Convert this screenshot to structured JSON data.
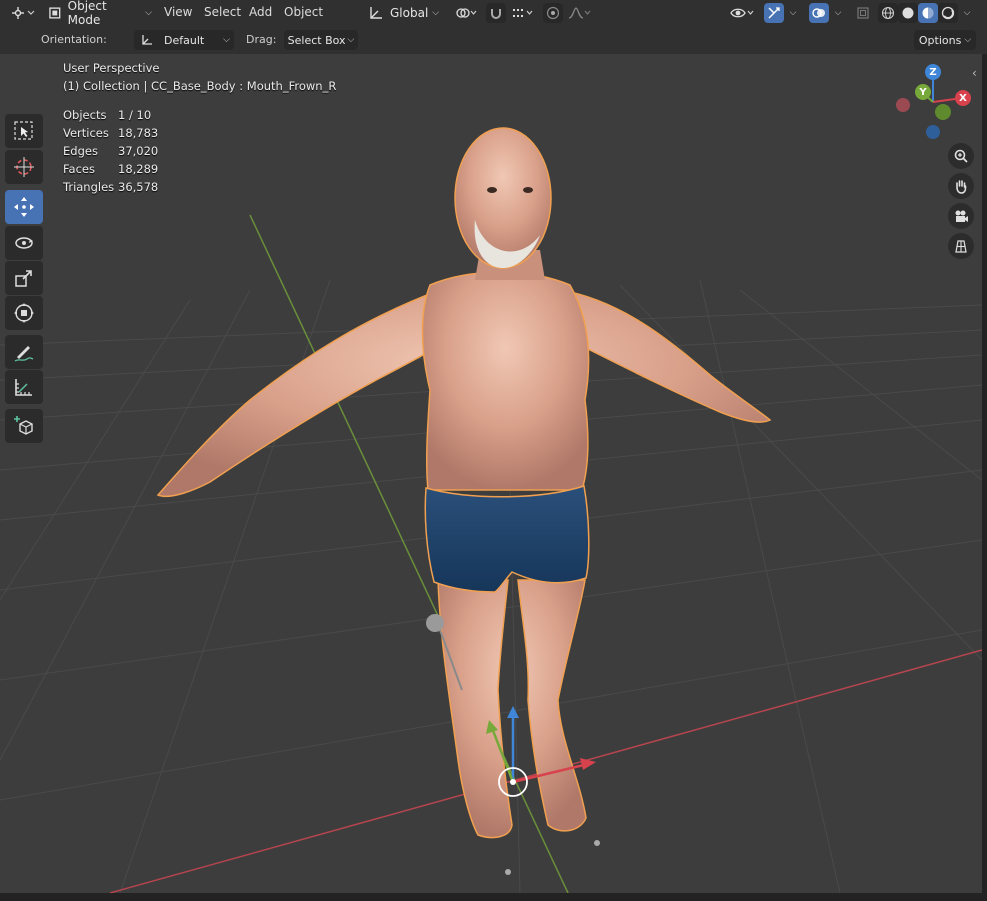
{
  "header": {
    "mode_label": "Object Mode",
    "menus": [
      "View",
      "Select",
      "Add",
      "Object"
    ],
    "transform_orientation": "Global"
  },
  "tool_settings": {
    "orientation_label": "Orientation:",
    "orientation_value": "Default",
    "drag_label": "Drag:",
    "drag_value": "Select Box",
    "options_label": "Options"
  },
  "overlay_text": {
    "view_name": "User Perspective",
    "collection_line": "(1) Collection | CC_Base_Body : Mouth_Frown_R",
    "stats": [
      {
        "label": "Objects",
        "value": "1 / 10"
      },
      {
        "label": "Vertices",
        "value": "18,783"
      },
      {
        "label": "Edges",
        "value": "37,020"
      },
      {
        "label": "Faces",
        "value": "18,289"
      },
      {
        "label": "Triangles",
        "value": "36,578"
      }
    ]
  },
  "navigation_gizmo": {
    "z": "Z",
    "y": "Y",
    "x": "X"
  },
  "toolbar_tools": [
    "select-box",
    "cursor",
    "move",
    "rotate",
    "scale",
    "transform",
    "annotate",
    "measure",
    "add-cube"
  ],
  "active_tool": "move",
  "colors": {
    "accent": "#4772b3",
    "selection_outline": "#f0a050",
    "x_axis": "#d8424d",
    "y_axis": "#76a83a",
    "z_axis": "#3f86d8"
  }
}
